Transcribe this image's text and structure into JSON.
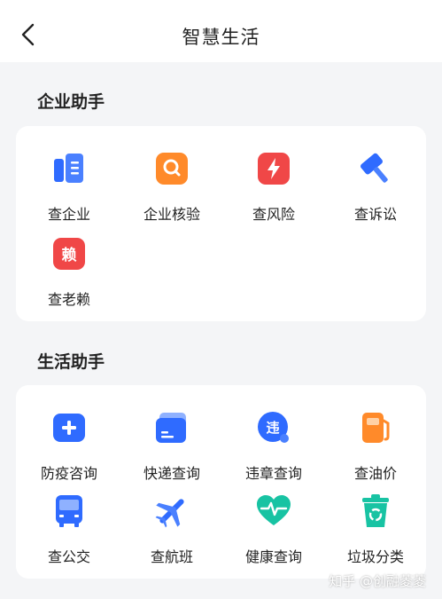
{
  "header": {
    "title": "智慧生活"
  },
  "sections": [
    {
      "title": "企业助手",
      "items": [
        {
          "label": "查企业",
          "icon": "document-icon"
        },
        {
          "label": "企业核验",
          "icon": "search-verify-icon"
        },
        {
          "label": "查风险",
          "icon": "risk-alert-icon"
        },
        {
          "label": "查诉讼",
          "icon": "gavel-icon"
        },
        {
          "label": "查老赖",
          "icon": "lai-badge-icon",
          "glyph": "赖"
        }
      ]
    },
    {
      "title": "生活助手",
      "items": [
        {
          "label": "防疫咨询",
          "icon": "medical-kit-icon"
        },
        {
          "label": "快递查询",
          "icon": "parcel-card-icon"
        },
        {
          "label": "违章查询",
          "icon": "violation-search-icon",
          "glyph": "违"
        },
        {
          "label": "查油价",
          "icon": "fuel-pump-icon"
        },
        {
          "label": "查公交",
          "icon": "bus-icon"
        },
        {
          "label": "查航班",
          "icon": "airplane-icon"
        },
        {
          "label": "健康查询",
          "icon": "heart-pulse-icon"
        },
        {
          "label": "垃圾分类",
          "icon": "recycle-bin-icon"
        }
      ]
    }
  ],
  "watermark": "知乎 @创融菱菱",
  "colors": {
    "blue": "#2f6bff",
    "orange": "#ff8a2a",
    "red": "#f04747",
    "teal": "#18c3a3",
    "background": "#f4f5f7"
  }
}
